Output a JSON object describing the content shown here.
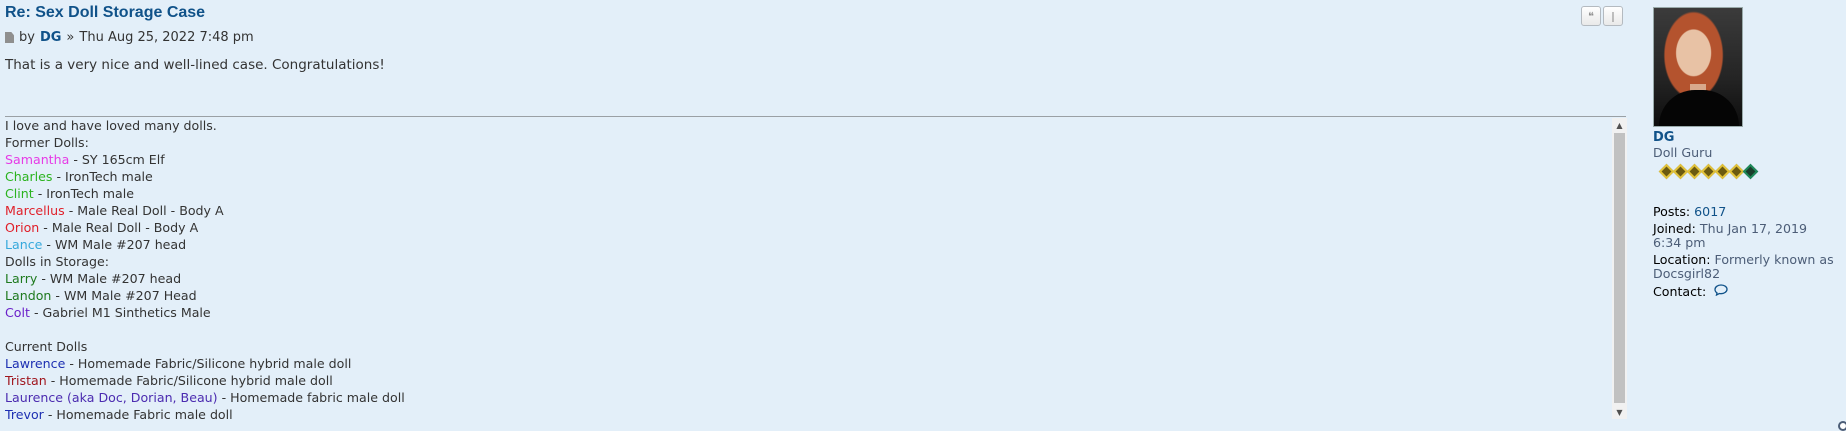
{
  "post": {
    "title": "Re: Sex Doll Storage Case",
    "by": "by",
    "author": "DG",
    "date_sep": "»",
    "date": "Thu Aug 25, 2022 7:48 pm",
    "content": "That is a very nice and well-lined case. Congratulations!",
    "buttons": [
      {
        "name": "quote-button",
        "icon": "quote-icon",
        "glyph": "❝"
      },
      {
        "name": "info-button",
        "icon": "info-icon",
        "glyph": "ǀ"
      }
    ]
  },
  "signature": {
    "lines": [
      {
        "name": "",
        "name_color": "",
        "text": "I love and have loved many dolls."
      },
      {
        "name": "",
        "name_color": "",
        "text": "Former Dolls:"
      },
      {
        "name": "Samantha",
        "name_color": "#e63be6",
        "text": " - SY 165cm Elf"
      },
      {
        "name": "Charles",
        "name_color": "#2bb31f",
        "text": " - IronTech male"
      },
      {
        "name": "Clint",
        "name_color": "#2bb31f",
        "text": " - IronTech male"
      },
      {
        "name": "Marcellus",
        "name_color": "#e0202a",
        "text": " - Male Real Doll - Body A"
      },
      {
        "name": "Orion",
        "name_color": "#e0202a",
        "text": " - Male Real Doll - Body A"
      },
      {
        "name": "Lance",
        "name_color": "#36a9dc",
        "text": " - WM Male #207 head"
      },
      {
        "name": "",
        "name_color": "",
        "text": "Dolls in Storage:"
      },
      {
        "name": "Larry",
        "name_color": "#1f7a1f",
        "text": " - WM Male #207 head"
      },
      {
        "name": "Landon",
        "name_color": "#1f7a1f",
        "text": " - WM Male #207 Head"
      },
      {
        "name": "Colt",
        "name_color": "#6a1fc9",
        "text": " - Gabriel M1 Sinthetics Male"
      },
      {
        "name": "",
        "name_color": "",
        "text": ""
      },
      {
        "name": "",
        "name_color": "",
        "text": "Current Dolls"
      },
      {
        "name": "Lawrence",
        "name_color": "#1d2fb2",
        "text": " - Homemade Fabric/Silicone hybrid male doll"
      },
      {
        "name": "Tristan",
        "name_color": "#a0171f",
        "text": " - Homemade Fabric/Silicone hybrid male doll"
      },
      {
        "name": "Laurence (aka Doc, Dorian, Beau)",
        "name_color": "#4b2bb0",
        "text": " - Homemade fabric male doll"
      },
      {
        "name": "Trevor",
        "name_color": "#1d2fb2",
        "text": " - Homemade Fabric male doll"
      }
    ]
  },
  "profile": {
    "username": "DG",
    "rank": "Doll Guru",
    "posts_label": "Posts:",
    "posts": "6017",
    "joined_label": "Joined:",
    "joined": "Thu Jan 17, 2019 6:34 pm",
    "location_label": "Location:",
    "location": "Formerly known as Docsgirl82",
    "contact_label": "Contact:"
  }
}
